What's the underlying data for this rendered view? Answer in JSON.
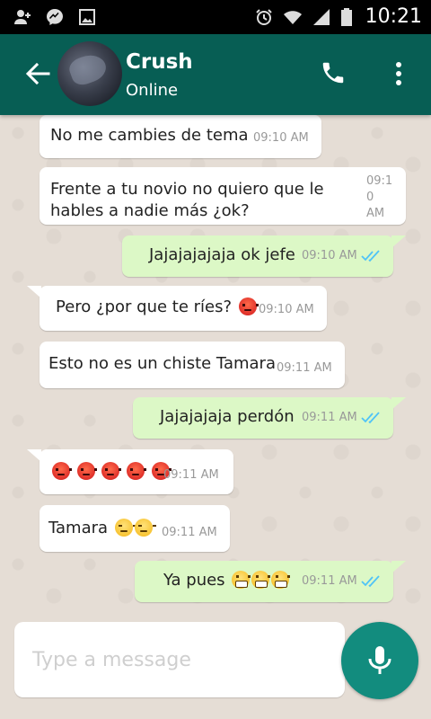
{
  "status_bar": {
    "time": "10:21",
    "left_icons": [
      "add-contact-icon",
      "messenger-icon",
      "image-icon"
    ],
    "right_icons": [
      "alarm-icon",
      "wifi-icon",
      "signal-icon",
      "battery-icon"
    ]
  },
  "header": {
    "contact_name": "Crush",
    "contact_status": "Online",
    "back_icon": "back-arrow-icon",
    "call_icon": "phone-icon",
    "menu_icon": "more-vert-icon"
  },
  "messages": [
    {
      "direction": "in",
      "text": "No me cambies de tema",
      "time": "09:10 AM"
    },
    {
      "direction": "in",
      "text_line1": "Frente a tu novio no quiero que le",
      "text_line2": "hables a nadie más ¿ok?",
      "time_line1": "09:1",
      "time_line2": "0",
      "time_line3": "AM"
    },
    {
      "direction": "out",
      "text": "Jajajajajaja ok jefe",
      "time": "09:10 AM",
      "status": "read"
    },
    {
      "direction": "in",
      "text": "Pero ¿por que te ríes?",
      "emoji": "angry-face",
      "time": "09:10 AM"
    },
    {
      "direction": "in",
      "text": "Esto no es un chiste Tamara",
      "time": "09:11 AM"
    },
    {
      "direction": "out",
      "text": "Jajajajaja perdón",
      "time": "09:11 AM",
      "status": "read"
    },
    {
      "direction": "in",
      "emoji": "angry-face",
      "emoji_count": 5,
      "time": "09:11 AM"
    },
    {
      "direction": "in",
      "text": "Tamara",
      "emoji": "unamused-face",
      "emoji_count": 2,
      "time": "09:11 AM"
    },
    {
      "direction": "out",
      "text": "Ya pues",
      "emoji": "grinning-face",
      "emoji_count": 3,
      "time": "09:11 AM",
      "status": "read"
    }
  ],
  "composer": {
    "placeholder": "Type a message",
    "mic_icon": "microphone-icon"
  },
  "colors": {
    "header_bg": "#075e54",
    "chat_bg": "#e5ddd5",
    "incoming_bubble": "#ffffff",
    "outgoing_bubble": "#dcf8c6",
    "read_ticks": "#4fc3f7",
    "mic_button": "#128c7e"
  }
}
